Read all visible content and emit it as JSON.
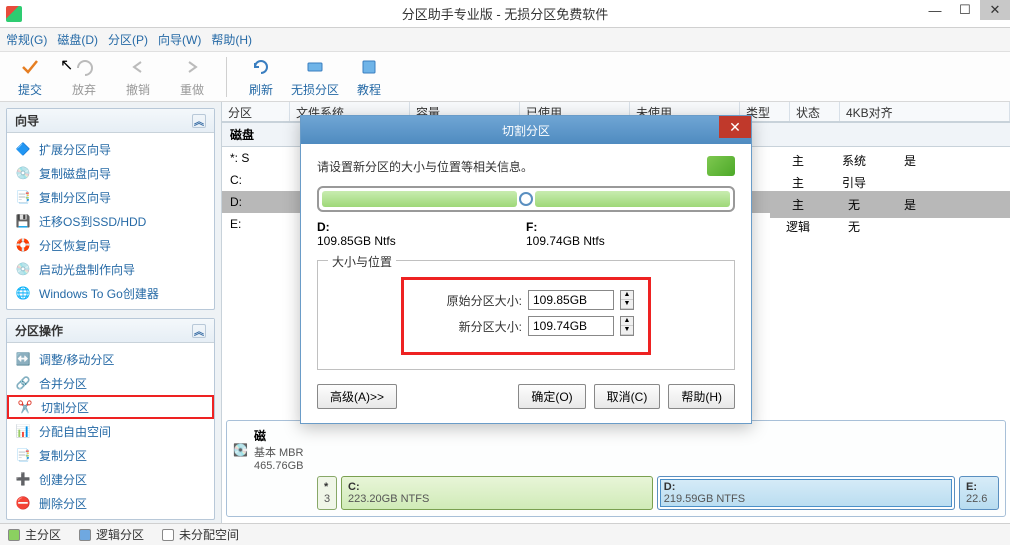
{
  "window": {
    "title": "分区助手专业版 - 无损分区免费软件"
  },
  "menu": {
    "items": [
      "常规(G)",
      "磁盘(D)",
      "分区(P)",
      "向导(W)",
      "帮助(H)"
    ]
  },
  "toolbar": {
    "commit": "提交",
    "discard": "放弃",
    "undo": "撤销",
    "redo": "重做",
    "refresh": "刷新",
    "resize": "无损分区",
    "tutorial": "教程"
  },
  "sidebar": {
    "wizard": {
      "title": "向导",
      "items": [
        {
          "label": "扩展分区向导"
        },
        {
          "label": "复制磁盘向导"
        },
        {
          "label": "复制分区向导"
        },
        {
          "label": "迁移OS到SSD/HDD"
        },
        {
          "label": "分区恢复向导"
        },
        {
          "label": "启动光盘制作向导"
        },
        {
          "label": "Windows To Go创建器"
        }
      ]
    },
    "ops": {
      "title": "分区操作",
      "items": [
        {
          "label": "调整/移动分区"
        },
        {
          "label": "合并分区"
        },
        {
          "label": "切割分区",
          "selected": true
        },
        {
          "label": "分配自由空间"
        },
        {
          "label": "复制分区"
        },
        {
          "label": "创建分区"
        },
        {
          "label": "删除分区"
        }
      ]
    }
  },
  "columns": [
    "分区",
    "文件系统",
    "容量",
    "已使用",
    "未使用",
    "类型",
    "状态",
    "4KB对齐"
  ],
  "disk": {
    "title": "磁盘",
    "rows": [
      {
        "label": "*: S",
        "type": "主",
        "status": "系统",
        "align": "是"
      },
      {
        "label": "C:",
        "type": "主",
        "status": "引导",
        "align": ""
      },
      {
        "label": "D:",
        "type": "主",
        "status": "无",
        "align": "是",
        "selected": true
      },
      {
        "label": "E:",
        "type": "逻辑",
        "status": "无",
        "align": ""
      }
    ]
  },
  "graphic": {
    "name_prefix": "磁",
    "sub1": "基本 MBR",
    "sub2": "465.76GB",
    "star_num": "*",
    "star_sub": "3",
    "c_label": "C:",
    "c_sub": "223.20GB NTFS",
    "d_label": "D:",
    "d_sub": "219.59GB NTFS",
    "e_label": "E:",
    "e_sub": "22.6"
  },
  "legend": {
    "primary": "主分区",
    "logical": "逻辑分区",
    "unalloc": "未分配空间"
  },
  "modal": {
    "title": "切割分区",
    "hint": "请设置新分区的大小与位置等相关信息。",
    "left_label": "D:",
    "left_size": "109.85GB Ntfs",
    "right_label": "F:",
    "right_size": "109.74GB Ntfs",
    "group_title": "大小与位置",
    "orig_label": "原始分区大小:",
    "orig_value": "109.85GB",
    "new_label": "新分区大小:",
    "new_value": "109.74GB",
    "advanced": "高级(A)>>",
    "ok": "确定(O)",
    "cancel": "取消(C)",
    "help": "帮助(H)"
  }
}
